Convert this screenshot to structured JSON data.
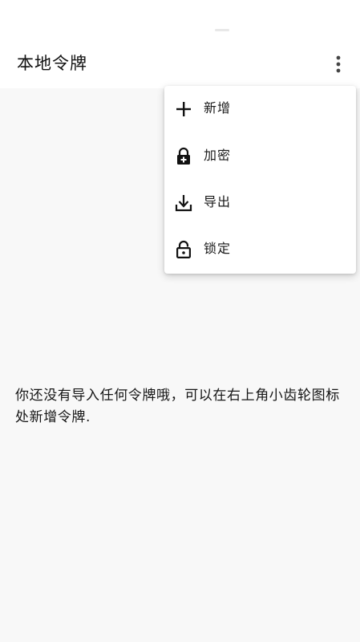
{
  "app_bar": {
    "title": "本地令牌",
    "overflow_icon": "more-vert-icon"
  },
  "menu": {
    "items": [
      {
        "label": "新增",
        "icon": "plus-icon"
      },
      {
        "label": "加密",
        "icon": "lock-plus-icon"
      },
      {
        "label": "导出",
        "icon": "download-icon"
      },
      {
        "label": "锁定",
        "icon": "lock-open-icon"
      }
    ]
  },
  "empty_state": {
    "message": "你还没有导入任何令牌哦，可以在右上角小齿轮图标处新增令牌."
  },
  "colors": {
    "background": "#f8f8f8",
    "surface": "#ffffff",
    "text": "#1a1a1a"
  }
}
